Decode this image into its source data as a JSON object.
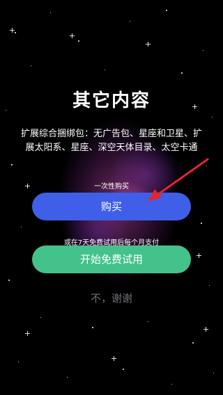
{
  "page": {
    "title": "其它内容",
    "description": "扩展综合捆绑包：无广告包、星座和卫星、扩展太阳系、星座、深空天体目录、太空卡通",
    "one_time_label": "一次性购买",
    "buy_label": "购买",
    "trial_terms": "或在7天免费试用后每个月支付",
    "trial_label": "开始免费试用",
    "decline_label": "不，谢谢"
  },
  "colors": {
    "buy_button": "#3f5fe8",
    "trial_button": "#43c28b",
    "decline_text": "#6f6f78",
    "annotation_arrow": "#e3262e"
  }
}
